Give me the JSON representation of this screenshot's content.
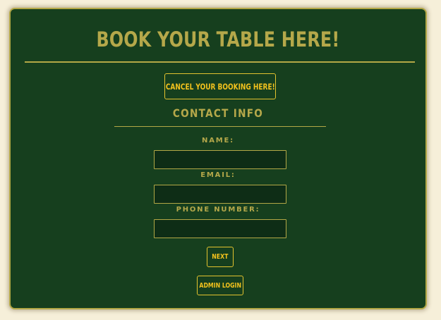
{
  "page": {
    "title": "Book Your Table Here!"
  },
  "actions": {
    "cancel_label": "Cancel Your Booking Here!",
    "next_label": "Next",
    "admin_label": "Admin Login"
  },
  "contact": {
    "heading": "Contact Info",
    "name_label": "Name:",
    "name_value": "",
    "email_label": "Email:",
    "email_value": "",
    "phone_label": "Phone Number:",
    "phone_value": ""
  },
  "colors": {
    "background": "#f6efd9",
    "card": "#163f1e",
    "accent_gold": "#b5a84a",
    "button_text": "#f2c21d",
    "input_bg": "#0e2d16"
  }
}
